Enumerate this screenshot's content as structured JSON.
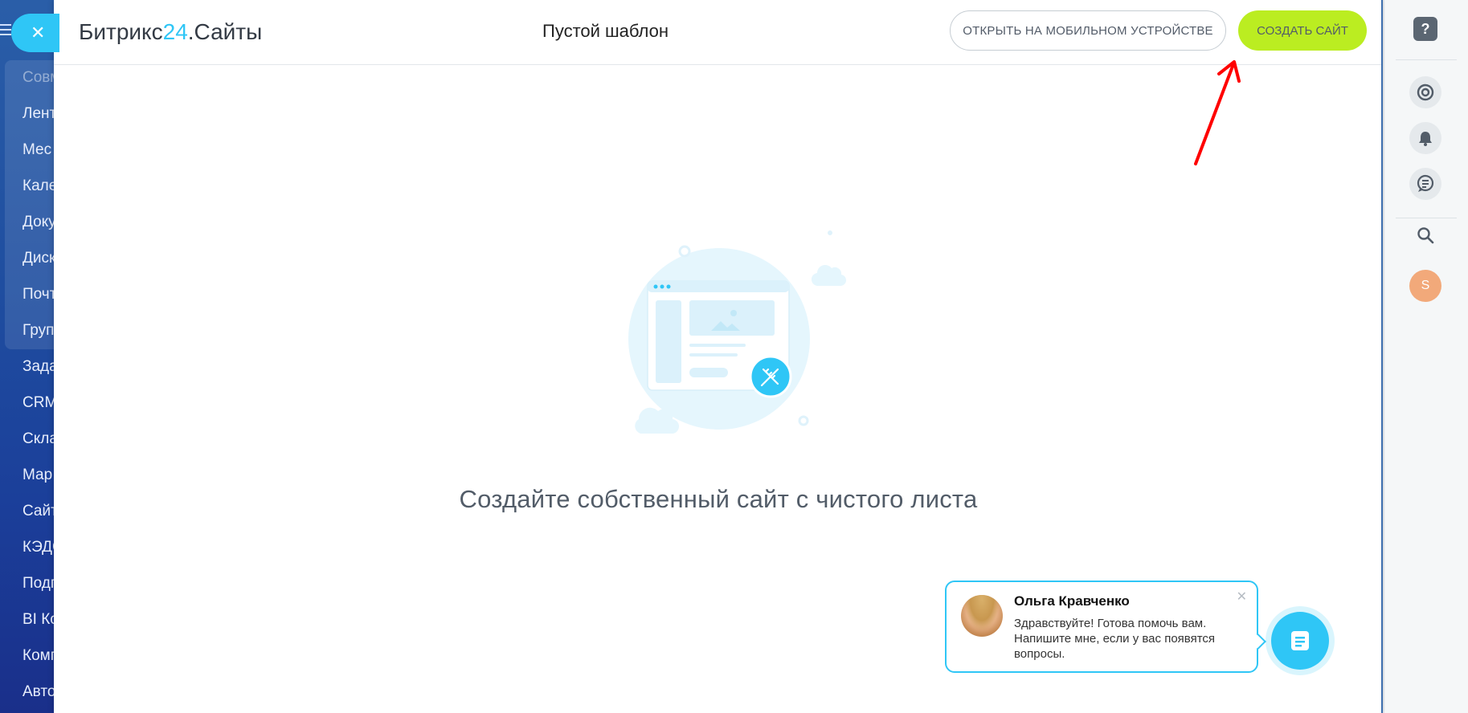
{
  "left_nav": {
    "items": [
      "Совм",
      "Лент",
      "Мес",
      "Кале",
      "Доку",
      "Диск",
      "Почт",
      "Груп",
      "Зада",
      "CRM",
      "Скла",
      "Мар",
      "Сайт",
      "КЭДС",
      "Подг",
      "BI Ко",
      "Комп",
      "Авто"
    ]
  },
  "header": {
    "logo_main": "Битрикс",
    "logo_accent": "24",
    "logo_suffix": ".Сайты",
    "title": "Пустой шаблон",
    "mobile_button": "Открыть на мобильном устройстве",
    "create_button": "Создать сайт"
  },
  "close_icon": "✕",
  "main": {
    "empty_text": "Создайте собственный сайт с чистого листа"
  },
  "chat": {
    "name": "Ольга Кравченко",
    "message": "Здравствуйте! Готова помочь вам. Напишите мне, если у вас появятся вопросы.",
    "close": "✕"
  },
  "right_bar": {
    "help": "?",
    "user_initial": "S"
  },
  "colors": {
    "accent": "#2fc6f6",
    "create_button": "#bbed21",
    "annotation": "#ff0000"
  },
  "icons": [
    "close-icon",
    "help-icon",
    "support-icon",
    "bell-icon",
    "chat-list-icon",
    "search-icon",
    "pencil-ruler-icon",
    "chat-icon"
  ]
}
